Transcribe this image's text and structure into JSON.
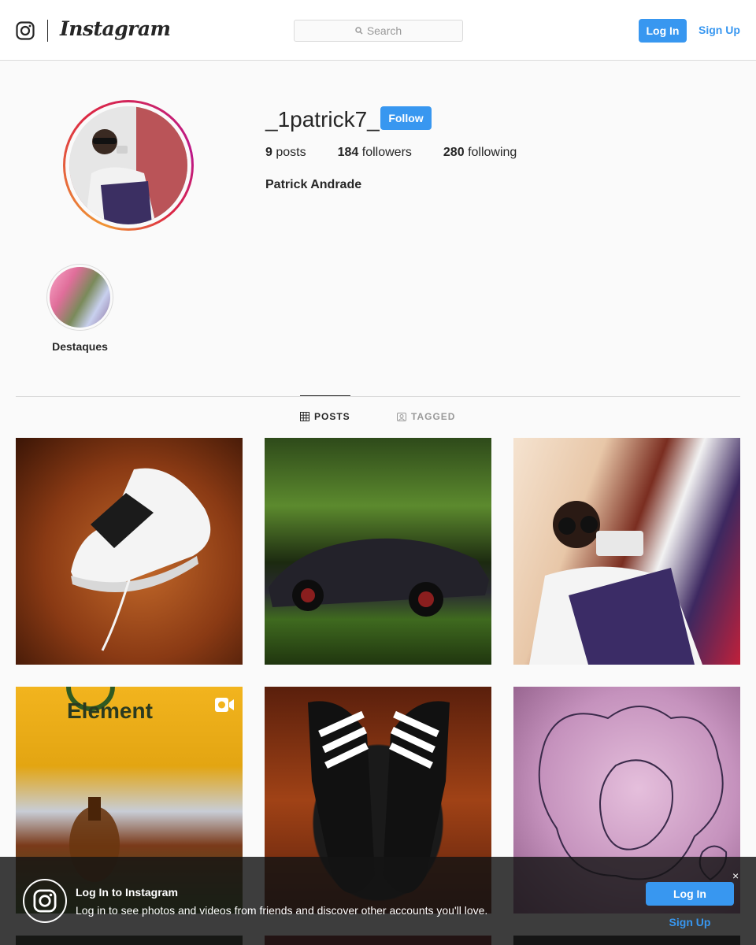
{
  "header": {
    "brand": "Instagram",
    "search_placeholder": "Search",
    "login_label": "Log In",
    "signup_label": "Sign Up"
  },
  "profile": {
    "username": "_1patrick7_",
    "follow_label": "Follow",
    "posts_count": "9",
    "posts_label": "posts",
    "followers_count": "184",
    "followers_label": "followers",
    "following_count": "280",
    "following_label": "following",
    "full_name": "Patrick Andrade"
  },
  "highlights": [
    {
      "label": "Destaques"
    }
  ],
  "tabs": [
    {
      "label": "POSTS",
      "active": true,
      "icon": "grid-icon"
    },
    {
      "label": "TAGGED",
      "active": false,
      "icon": "tagged-icon"
    }
  ],
  "posts": [
    {
      "description": "white sneaker",
      "video": false
    },
    {
      "description": "black sports car",
      "video": false
    },
    {
      "description": "selfie with sunglasses",
      "video": false
    },
    {
      "description": "yellow Element sweatshirt",
      "video": true
    },
    {
      "description": "black adidas slides",
      "video": false
    },
    {
      "description": "pink drawing",
      "video": false
    }
  ],
  "banner": {
    "title": "Log In to Instagram",
    "text": "Log in to see photos and videos from friends and discover other accounts you'll love.",
    "close_label": "×",
    "login_label": "Log In",
    "signup_label": "Sign Up"
  },
  "colors": {
    "accent": "#3897f0",
    "text": "#262626",
    "muted": "#999999",
    "border": "#dbdbdb"
  }
}
